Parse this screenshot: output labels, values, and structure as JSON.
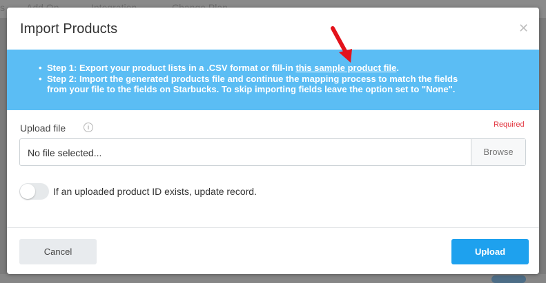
{
  "background": {
    "tabs": [
      "s",
      "Add On",
      "Integration",
      "Change Plan"
    ]
  },
  "dialog": {
    "title": "Import Products",
    "close_glyph": "✕",
    "info": {
      "step1_prefix": "Step 1: Export your product lists in a .CSV format or fill-in ",
      "step1_link": "this sample product file",
      "step1_suffix": ".",
      "step2_line1": "Step 2: Import the generated products file and continue the mapping process to match the fields",
      "step2_line2": "from your file to the fields on Starbucks. To skip importing fields leave the option set to \"None\"."
    },
    "upload": {
      "label": "Upload file",
      "info_glyph": "i",
      "required": "Required",
      "file_value": "No file selected...",
      "browse": "Browse"
    },
    "toggle": {
      "label": "If an uploaded product ID exists, update record.",
      "checked": false
    },
    "buttons": {
      "cancel": "Cancel",
      "upload": "Upload"
    }
  },
  "colors": {
    "info_bg": "#5bbdf4",
    "upload_btn": "#1ea1ee",
    "required": "#e2333d",
    "arrow": "#e3121b"
  },
  "icons": [
    "close-icon",
    "info-icon",
    "red-arrow-annotation"
  ]
}
